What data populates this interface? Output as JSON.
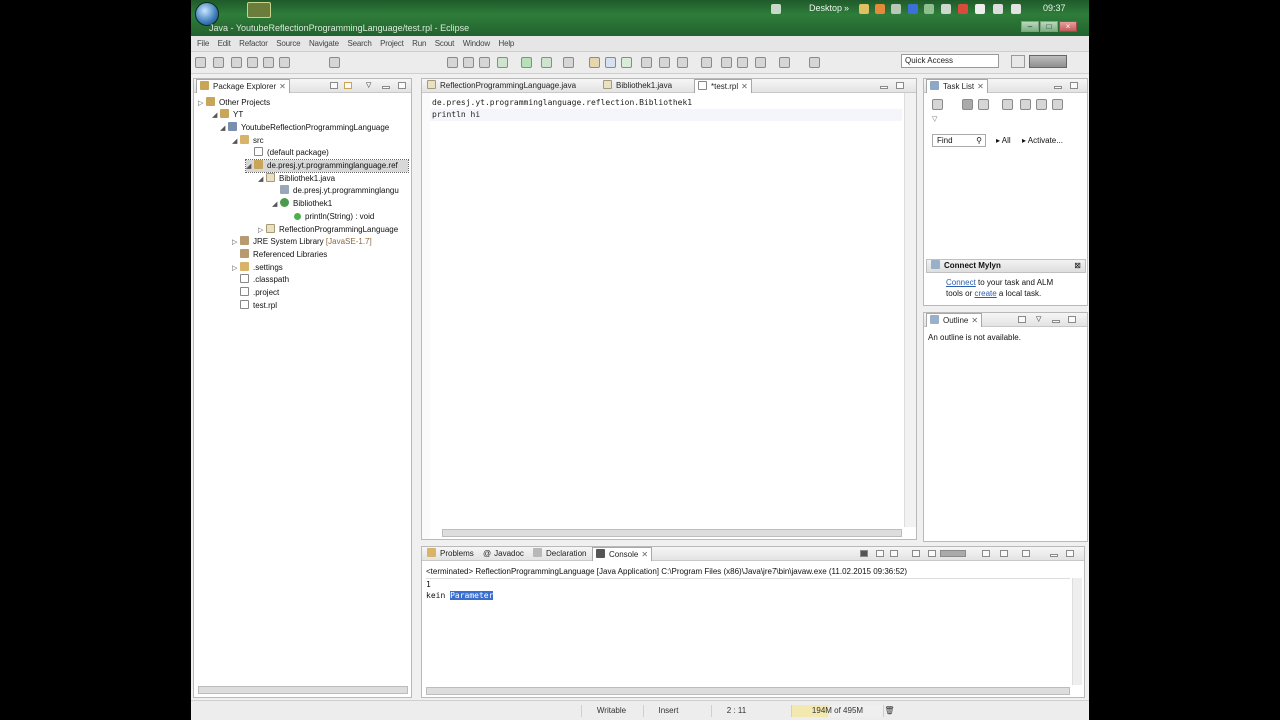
{
  "window": {
    "title": "Java - YoutubeReflectionProgrammingLanguage/test.rpl - Eclipse",
    "tray": {
      "desktop_label": "Desktop",
      "chevron": "»",
      "clock": "09:37"
    }
  },
  "menu": [
    "File",
    "Edit",
    "Refactor",
    "Source",
    "Navigate",
    "Search",
    "Project",
    "Run",
    "Scout",
    "Window",
    "Help"
  ],
  "quick_access": {
    "placeholder": "Quick Access"
  },
  "package_explorer": {
    "tab_label": "Package Explorer",
    "items": [
      {
        "label": "Other Projects"
      },
      {
        "label": "YT"
      },
      {
        "label": "YoutubeReflectionProgrammingLanguage"
      },
      {
        "label": "src"
      },
      {
        "label": "(default package)"
      },
      {
        "label": "de.presj.yt.programminglanguage.ref"
      },
      {
        "label": "Bibliothek1.java"
      },
      {
        "label": "de.presj.yt.programminglangu"
      },
      {
        "label": "Bibliothek1"
      },
      {
        "label": "println(String) : void"
      },
      {
        "label": "ReflectionProgrammingLanguage"
      },
      {
        "label": "JRE System Library",
        "suffix": "[JavaSE-1.7]"
      },
      {
        "label": "Referenced Libraries"
      },
      {
        "label": ".settings"
      },
      {
        "label": ".classpath"
      },
      {
        "label": ".project"
      },
      {
        "label": "test.rpl"
      }
    ]
  },
  "editor": {
    "tabs": [
      {
        "label": "ReflectionProgrammingLanguage.java"
      },
      {
        "label": "Bibliothek1.java"
      },
      {
        "label": "*test.rpl"
      }
    ],
    "lines": [
      "de.presj.yt.programminglanguage.reflection.Bibliothek1",
      "println hi"
    ]
  },
  "task_list": {
    "tab_label": "Task List",
    "find_placeholder": "Find",
    "all_label": "All",
    "activate_label": "Activate...",
    "mylyn": {
      "title": "Connect Mylyn",
      "connect_link": "Connect",
      "text1": " to your task and ALM",
      "text2": "tools or ",
      "create_link": "create",
      "text3": " a local task."
    }
  },
  "outline": {
    "tab_label": "Outline",
    "message": "An outline is not available."
  },
  "console_view": {
    "tabs": [
      {
        "label": "Problems"
      },
      {
        "label": "Javadoc"
      },
      {
        "label": "Declaration"
      },
      {
        "label": "Console"
      }
    ],
    "header": "<terminated> ReflectionProgrammingLanguage [Java Application] C:\\Program Files (x86)\\Java\\jre7\\bin\\javaw.exe (11.02.2015 09:36:52)",
    "lines": [
      "1",
      "kein "
    ],
    "highlight": "Parameter"
  },
  "status_bar": {
    "writable": "Writable",
    "insert": "Insert",
    "position": "2 : 11",
    "heap": "194M of 495M"
  }
}
